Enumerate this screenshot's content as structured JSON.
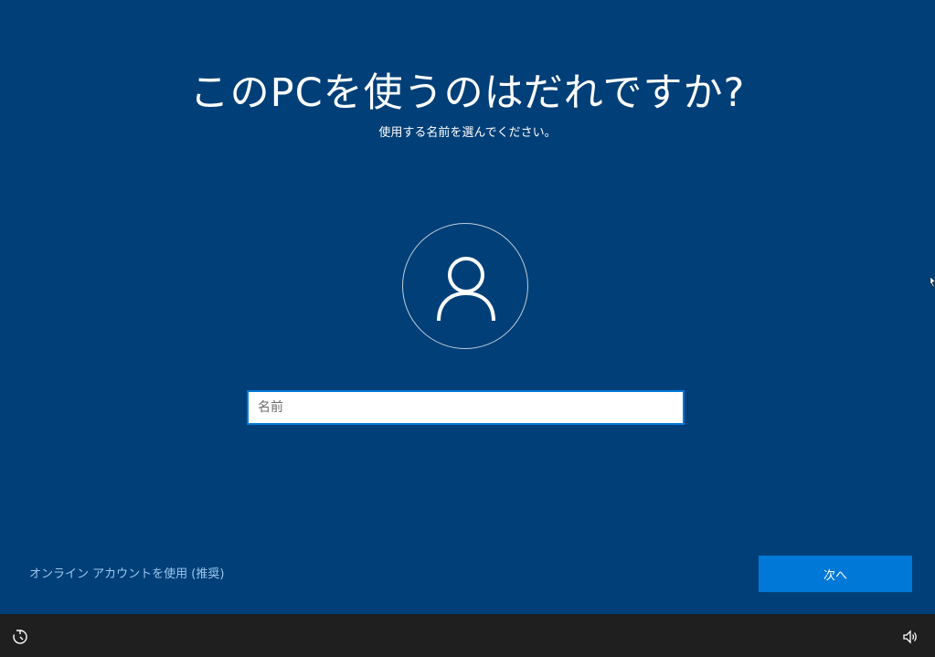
{
  "page": {
    "title": "このPCを使うのはだれですか?",
    "subtitle": "使用する名前を選んでください。"
  },
  "avatar": {
    "icon": "user-icon"
  },
  "name_field": {
    "placeholder": "名前",
    "value": ""
  },
  "footer": {
    "online_account_link": "オンライン アカウントを使用 (推奨)",
    "next_button": "次へ"
  },
  "taskbar": {
    "left_icon": "ease-of-access-icon",
    "right_icon": "volume-icon"
  },
  "colors": {
    "background": "#003f77",
    "accent": "#0078d7",
    "taskbar": "#1f1f1f",
    "link": "#9cc8f0"
  }
}
